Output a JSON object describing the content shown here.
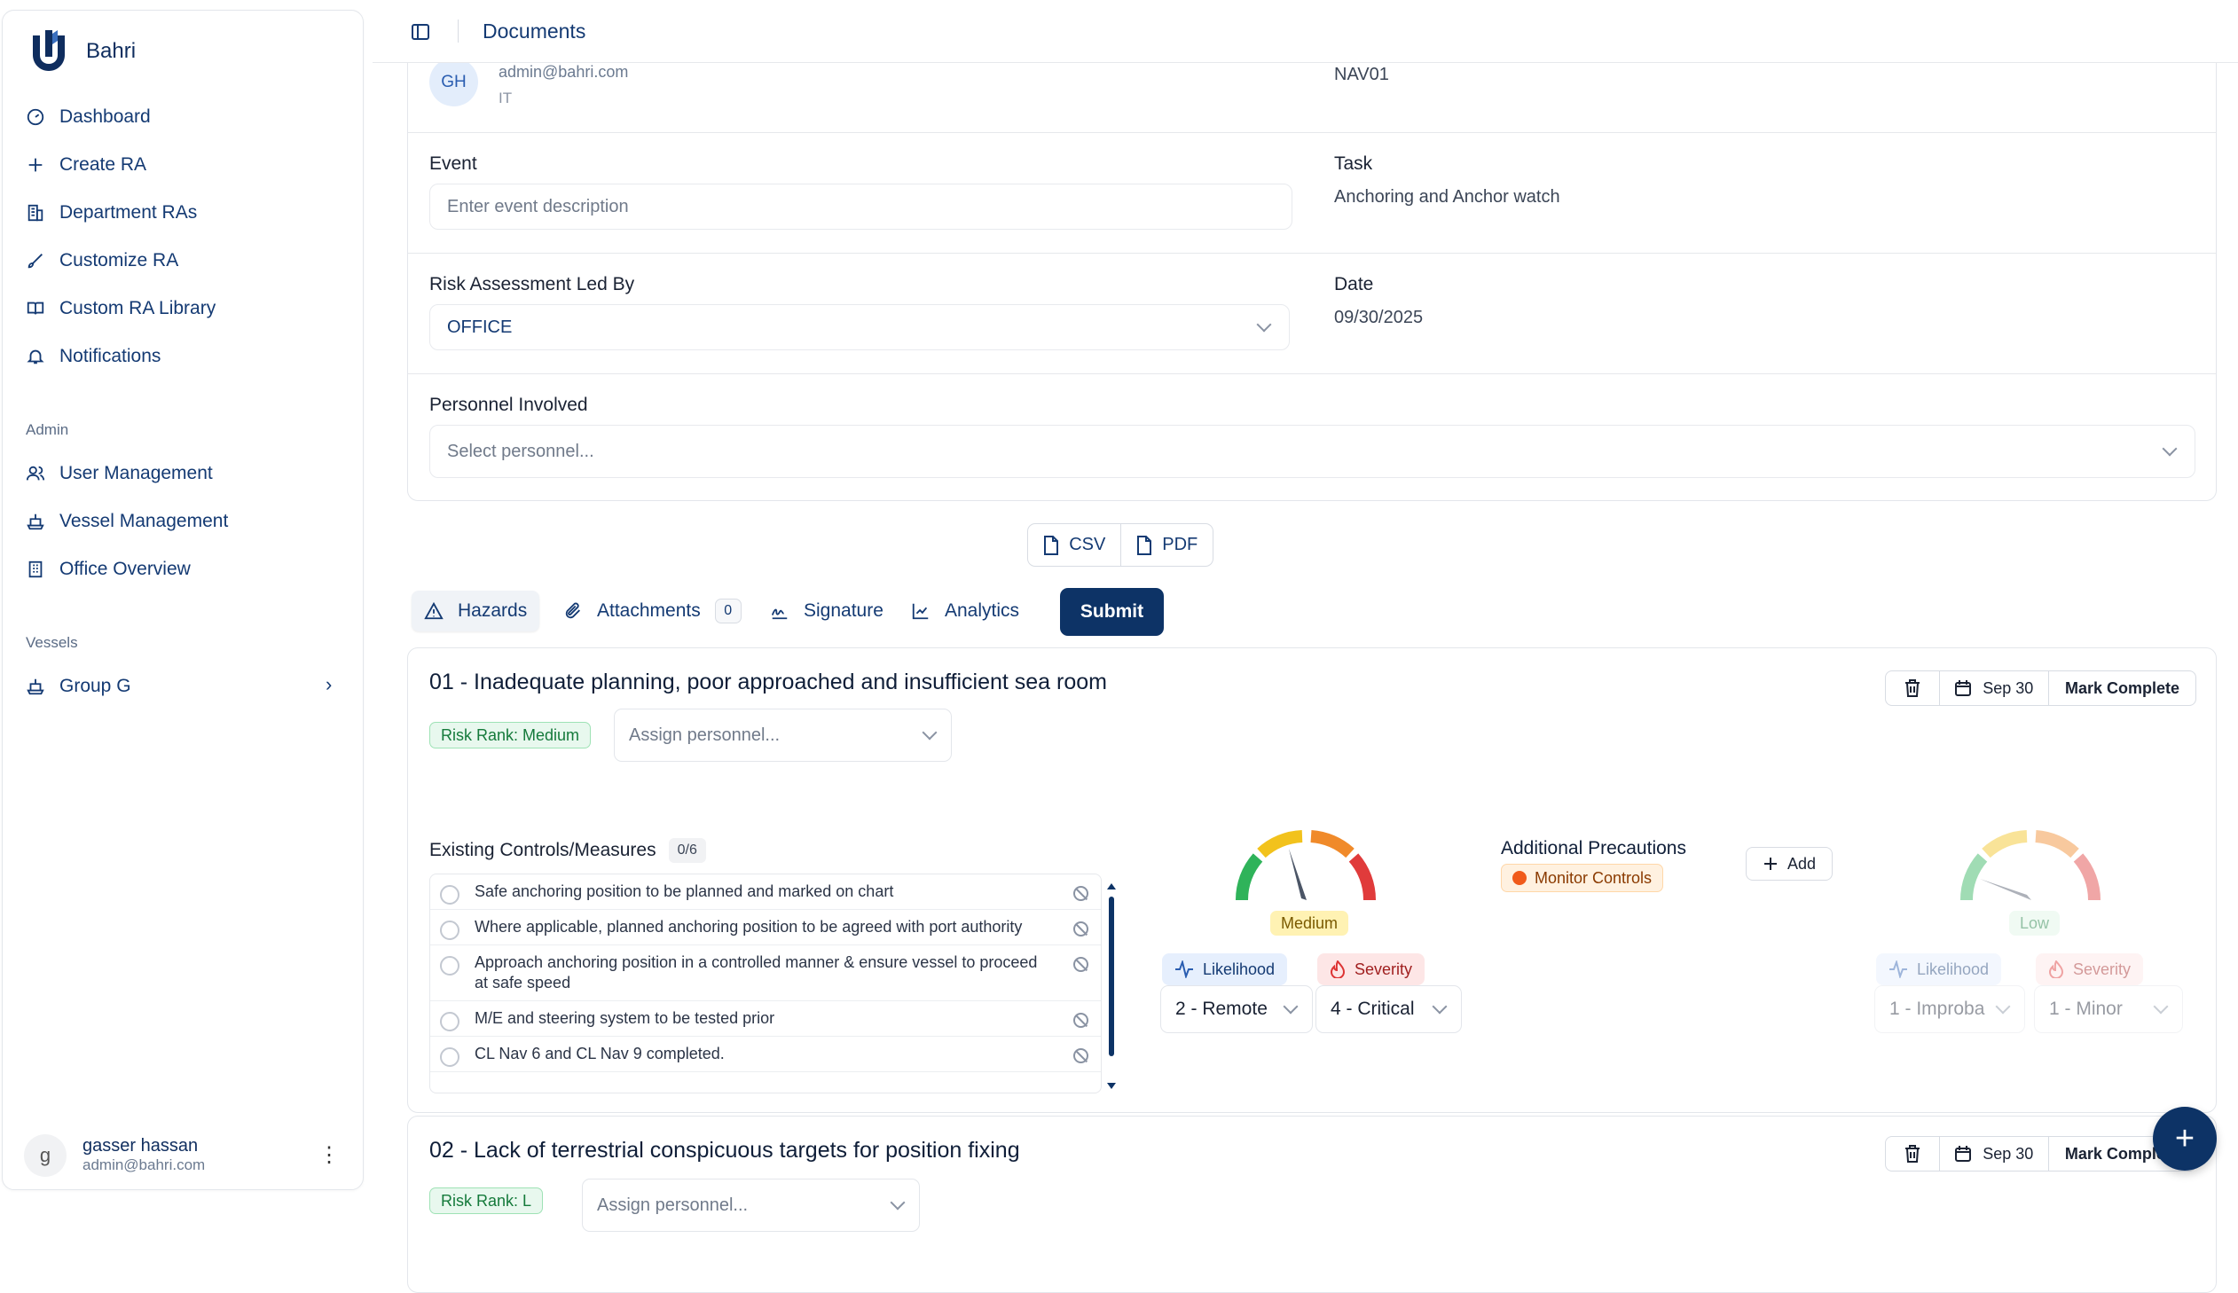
{
  "app": {
    "name": "Bahri"
  },
  "sidebar": {
    "items": [
      {
        "label": "Dashboard",
        "icon": "gauge-icon"
      },
      {
        "label": "Create RA",
        "icon": "plus-icon"
      },
      {
        "label": "Department RAs",
        "icon": "building-icon"
      },
      {
        "label": "Customize RA",
        "icon": "brush-icon"
      },
      {
        "label": "Custom RA Library",
        "icon": "book-icon"
      },
      {
        "label": "Notifications",
        "icon": "bell-icon"
      }
    ],
    "admin_label": "Admin",
    "admin_items": [
      {
        "label": "User Management",
        "icon": "users-icon"
      },
      {
        "label": "Vessel Management",
        "icon": "ship-icon"
      },
      {
        "label": "Office Overview",
        "icon": "office-icon"
      }
    ],
    "vessels_label": "Vessels",
    "vessel_group": {
      "label": "Group G",
      "icon": "ship-icon"
    },
    "user": {
      "initial": "g",
      "name": "gasser hassan",
      "email": "admin@bahri.com"
    }
  },
  "topbar": {
    "title": "Documents"
  },
  "details": {
    "avatar_initials": "GH",
    "email": "admin@bahri.com",
    "department": "IT",
    "vessel_code": "NAV01",
    "event_label": "Event",
    "event_placeholder": "Enter event description",
    "task_label": "Task",
    "task_value": "Anchoring and Anchor watch",
    "led_by_label": "Risk Assessment Led By",
    "led_by_value": "OFFICE",
    "date_label": "Date",
    "date_value": "09/30/2025",
    "personnel_label": "Personnel Involved",
    "personnel_placeholder": "Select personnel..."
  },
  "export": {
    "csv": "CSV",
    "pdf": "PDF"
  },
  "tabs": {
    "hazards": "Hazards",
    "attachments": "Attachments",
    "attachments_count": "0",
    "signature": "Signature",
    "analytics": "Analytics",
    "submit": "Submit"
  },
  "hazards": [
    {
      "title": "01 -  Inadequate planning, poor approached and insufficient sea room",
      "date": "Sep 30",
      "mark_complete": "Mark Complete",
      "risk_rank": "Risk Rank: Medium",
      "assign_placeholder": "Assign personnel...",
      "controls_label": "Existing Controls/Measures",
      "controls_count": "0/6",
      "controls": [
        "Safe anchoring position to be planned and marked on chart",
        "Where applicable, planned anchoring position to be agreed with port authority",
        "Approach anchoring position in a controlled manner & ensure vessel to proceed at safe speed",
        "M/E and steering system to be tested prior",
        "CL Nav 6 and CL Nav 9 completed."
      ],
      "current_risk": {
        "level": "Medium",
        "likelihood_label": "Likelihood",
        "severity_label": "Severity",
        "likelihood": "2 - Remote",
        "severity": "4 - Critical"
      },
      "additional_label": "Additional Precautions",
      "monitor_label": "Monitor Controls",
      "add_label": "Add",
      "residual_risk": {
        "level": "Low",
        "likelihood_label": "Likelihood",
        "severity_label": "Severity",
        "likelihood": "1 - Improba",
        "severity": "1 - Minor"
      }
    },
    {
      "title": "02 -  Lack of terrestrial conspicuous targets for position fixing",
      "date": "Sep 30",
      "mark_complete": "Mark Comple",
      "risk_rank": "Risk Rank: L",
      "assign_placeholder": "Assign personnel..."
    }
  ],
  "colors": {
    "primary": "#0d3366",
    "link": "#143a73",
    "medium": "#fff2b3",
    "low": "#dff5e5"
  }
}
